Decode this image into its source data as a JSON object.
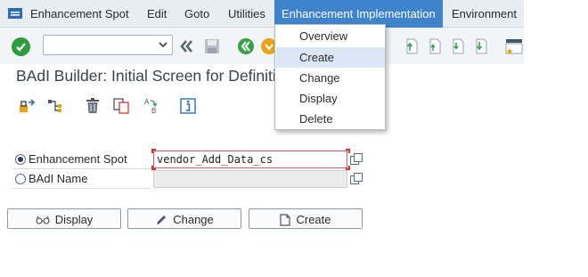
{
  "menubar": {
    "items": [
      "Enhancement Spot",
      "Edit",
      "Goto",
      "Utilities",
      "Enhancement Implementation",
      "Environment"
    ]
  },
  "dropdown": {
    "items": [
      "Overview",
      "Create",
      "Change",
      "Display",
      "Delete"
    ],
    "hovered": "Create"
  },
  "title": "BAdI Builder: Initial Screen for Definiti",
  "form": {
    "spot_label": "Enhancement Spot",
    "spot_value": "vendor_Add_Data_cs",
    "badi_label": "BAdI Name",
    "badi_value": "",
    "selected": "Enhancement Spot"
  },
  "buttons": {
    "display": "Display",
    "change": "Change",
    "create": "Create"
  },
  "icons": {
    "menubar": "sap-menu-icon",
    "toolbar": [
      "ok-check-icon",
      "dropdown-arrow-icon",
      "back-double-arrow-icon",
      "save-icon",
      "back-green-icon",
      "exit-yellow-icon",
      "first-page-icon",
      "previous-page-icon",
      "next-page-icon",
      "last-page-icon",
      "layout-icon"
    ],
    "app_toolbar": [
      "other-object-icon",
      "hierarchy-icon",
      "delete-icon",
      "copy-icon",
      "rename-icon",
      "info-icon"
    ]
  },
  "colors": {
    "menu_active": "#3f83cd",
    "ok_green": "#2e9d3d",
    "dropdown_hover": "#dbe7f4"
  }
}
